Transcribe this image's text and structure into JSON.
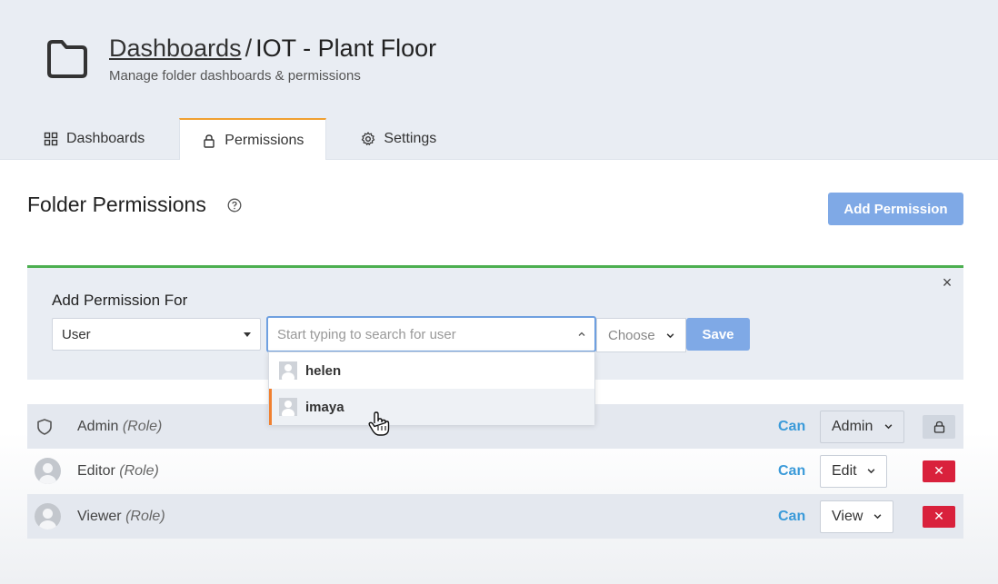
{
  "header": {
    "breadcrumb_root": "Dashboards",
    "separator": "/",
    "folder_name": "IOT - Plant Floor",
    "subtitle": "Manage folder dashboards & permissions"
  },
  "tabs": [
    {
      "label": "Dashboards",
      "icon": "grid-icon",
      "active": false
    },
    {
      "label": "Permissions",
      "icon": "lock-icon",
      "active": true
    },
    {
      "label": "Settings",
      "icon": "gear-icon",
      "active": false
    }
  ],
  "section": {
    "title": "Folder Permissions",
    "add_button": "Add Permission"
  },
  "add_panel": {
    "title": "Add Permission For",
    "type_select": "User",
    "search_placeholder": "Start typing to search for user",
    "permission_select": "Choose",
    "save_button": "Save",
    "close": "×",
    "options": [
      {
        "name": "helen"
      },
      {
        "name": "imaya"
      }
    ]
  },
  "permissions": [
    {
      "name": "Admin",
      "role_suffix": "(Role)",
      "can": "Can",
      "level": "Admin",
      "action": "lock"
    },
    {
      "name": "Editor",
      "role_suffix": "(Role)",
      "can": "Can",
      "level": "Edit",
      "action": "delete"
    },
    {
      "name": "Viewer",
      "role_suffix": "(Role)",
      "can": "Can",
      "level": "View",
      "action": "delete"
    }
  ],
  "colors": {
    "accent_blue": "#7fa9e6",
    "can_blue": "#3a9ad9",
    "panel_green": "#4caf50",
    "danger_red": "#d9213c",
    "tab_orange": "#f0a030"
  }
}
